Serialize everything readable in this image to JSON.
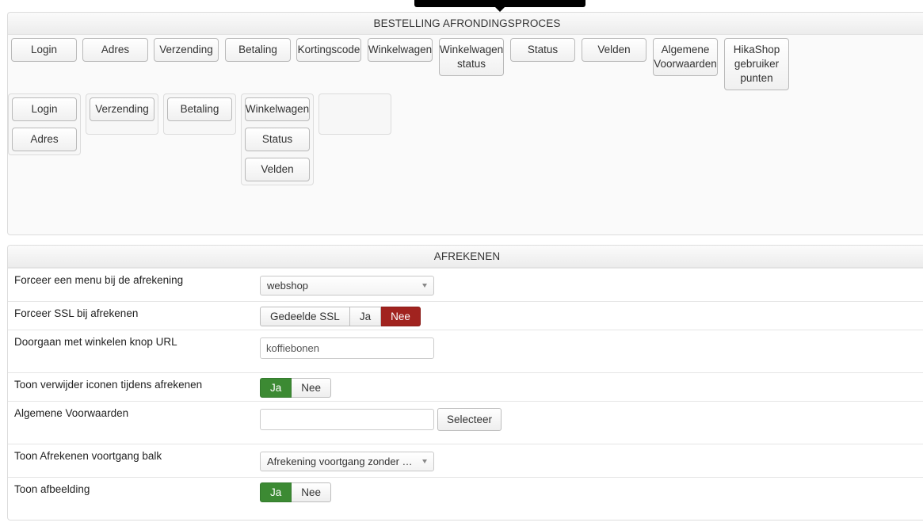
{
  "checkout_flow": {
    "title": "BESTELLING AFRONDINGSPROCES",
    "available_steps": [
      "Login",
      "Adres",
      "Verzending",
      "Betaling",
      "Kortingscode",
      "Winkelwagen",
      "Winkelwagen status",
      "Status",
      "Velden",
      "Algemene Voorwaarden",
      "HikaShop gebruiker punten"
    ],
    "workflow_columns": [
      [
        "Login",
        "Adres"
      ],
      [
        "Verzending"
      ],
      [
        "Betaling"
      ],
      [
        "Winkelwagen",
        "Status",
        "Velden"
      ],
      []
    ]
  },
  "checkout_settings": {
    "title": "AFREKENEN",
    "force_menu": {
      "label": "Forceer een menu bij de afrekening",
      "value": "webshop"
    },
    "force_ssl": {
      "label": "Forceer SSL bij afrekenen",
      "options": [
        "Gedeelde SSL",
        "Ja",
        "Nee"
      ],
      "selected": "Nee"
    },
    "continue_url": {
      "label": "Doorgaan met winkelen knop URL",
      "value": "koffiebonen"
    },
    "show_delete_icons": {
      "label": "Toon verwijder iconen tijdens afrekenen",
      "options": [
        "Ja",
        "Nee"
      ],
      "selected": "Ja"
    },
    "terms": {
      "label": "Algemene Voorwaarden",
      "value": "",
      "button": "Selecteer"
    },
    "progress_bar": {
      "label": "Toon Afrekenen voortgang balk",
      "value": "Afrekening voortgang zonder …"
    },
    "show_image": {
      "label": "Toon afbeelding",
      "options": [
        "Ja",
        "Nee"
      ],
      "selected": "Ja"
    }
  },
  "colors": {
    "danger": "#a1231f",
    "success": "#3c8a33"
  }
}
